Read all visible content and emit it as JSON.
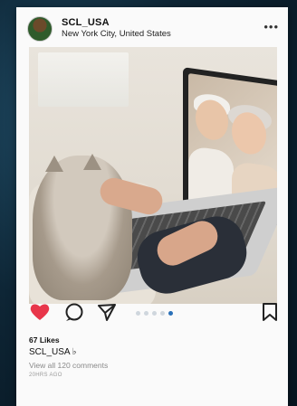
{
  "post": {
    "username": "SCL_USA",
    "location": "New York City, United States",
    "more_label": "•••",
    "likes": "67 Likes",
    "caption": "SCL_USA ♭",
    "comments_link": "View all 120 comments",
    "time_ago": "20HRS AGO"
  },
  "carousel": {
    "count": 5,
    "active_index": 4
  },
  "colors": {
    "like_red": "#e8364a",
    "active_dot": "#2a70b8",
    "card_bg": "#fafafa"
  }
}
